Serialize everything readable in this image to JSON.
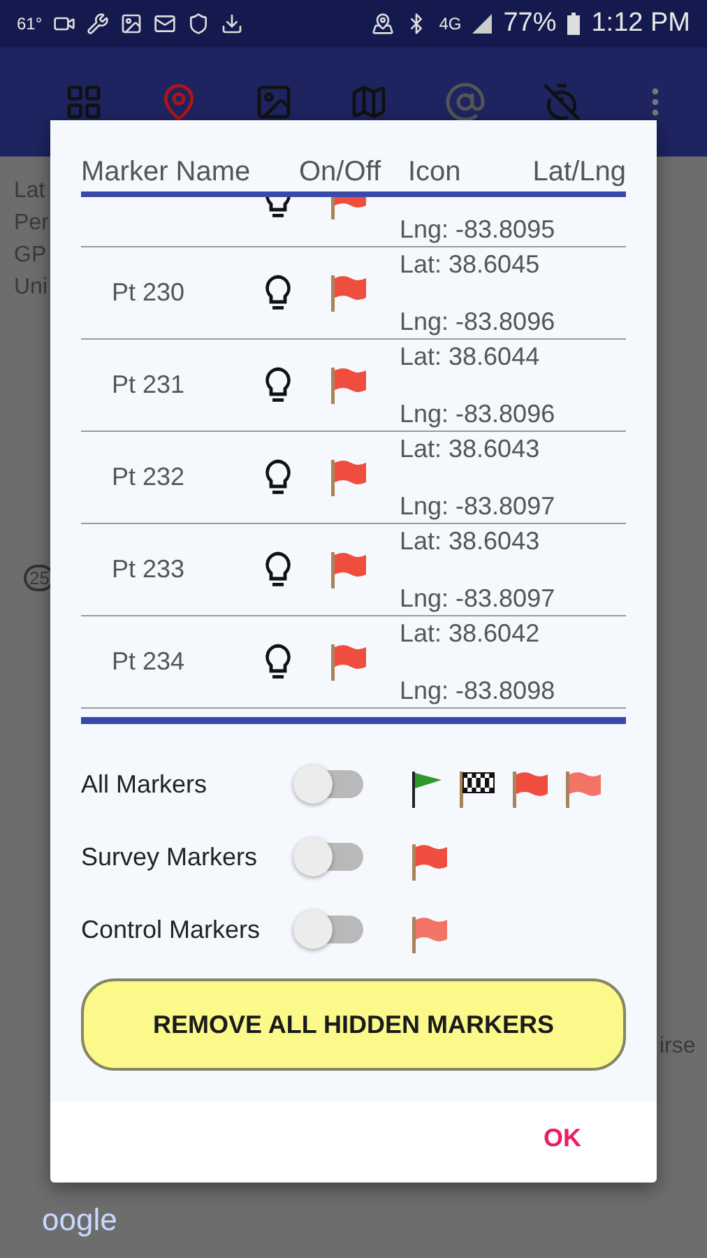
{
  "status_bar": {
    "temperature": "61°",
    "network": "4G",
    "battery": "77%",
    "time": "1:12 PM"
  },
  "background_text": {
    "left": [
      "Lat",
      "Per",
      "GP",
      "Uni"
    ],
    "right": "irse",
    "road_badge": "25",
    "logo": "oogle"
  },
  "dialog": {
    "columns": [
      "Marker Name",
      "On/Off",
      "Icon",
      "Lat/Lng"
    ],
    "markers": [
      {
        "lit": false,
        "lng": "Lng: -83.8095"
      },
      {
        "name": "Pt 230",
        "lit": false,
        "lat": "Lat: 38.6045",
        "lng": "Lng: -83.8096"
      },
      {
        "name": "Pt 231",
        "lit": false,
        "lat": "Lat: 38.6044",
        "lng": "Lng: -83.8096"
      },
      {
        "name": "Pt 232",
        "lit": false,
        "lat": "Lat: 38.6043",
        "lng": "Lng: -83.8097"
      },
      {
        "name": "Pt 233",
        "lit": false,
        "lat": "Lat: 38.6043",
        "lng": "Lng: -83.8097"
      },
      {
        "name": "Pt 234",
        "lit": false,
        "lat": "Lat: 38.6042",
        "lng": "Lng: -83.8098"
      }
    ],
    "groups": [
      {
        "label": "All Markers",
        "on": false,
        "flags": [
          {
            "kind": "pennant",
            "color": "#2e9a2e"
          },
          {
            "kind": "checkered"
          },
          {
            "kind": "flag",
            "color": "#ef4e3e"
          },
          {
            "kind": "flag",
            "color": "#f27466"
          }
        ]
      },
      {
        "label": "Survey Markers",
        "on": false,
        "flags": [
          {
            "kind": "flag",
            "color": "#ef4e3e"
          }
        ]
      },
      {
        "label": "Control Markers",
        "on": false,
        "flags": [
          {
            "kind": "flag",
            "color": "#f27466"
          }
        ]
      }
    ],
    "remove_button": "REMOVE ALL HIDDEN MARKERS",
    "ok_button": "OK"
  }
}
